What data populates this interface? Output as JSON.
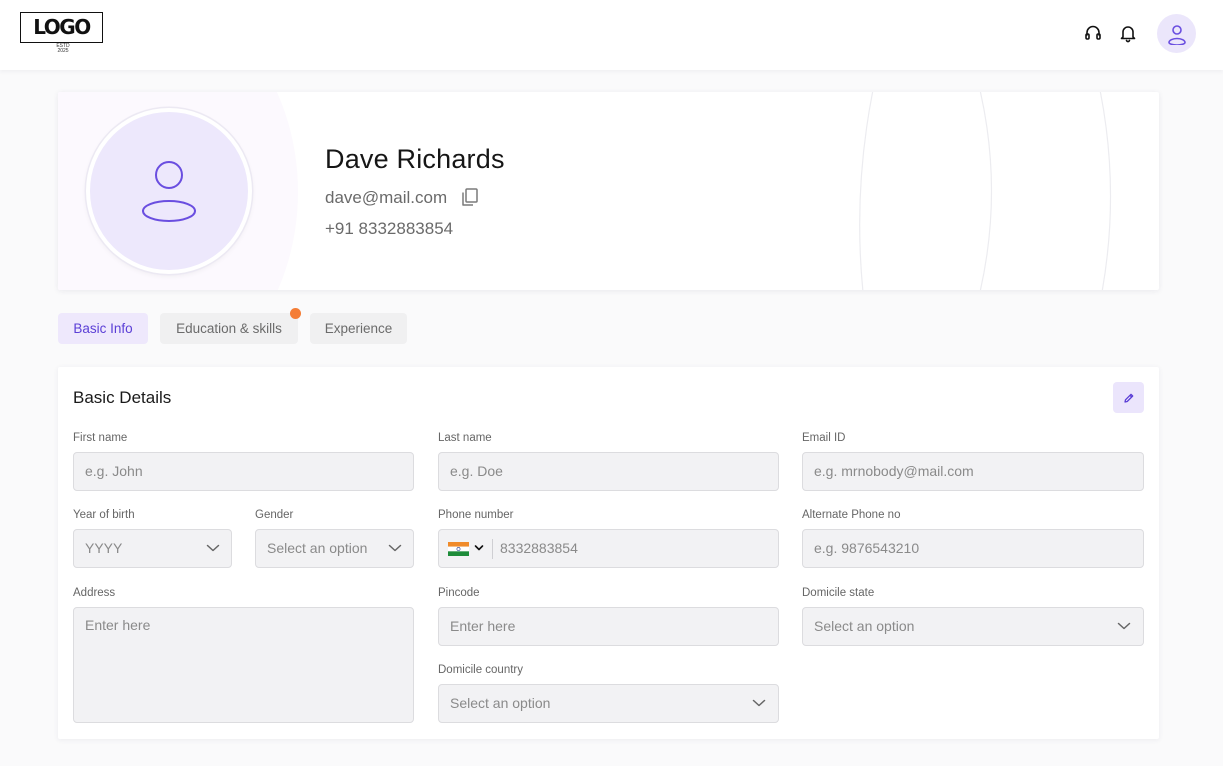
{
  "header": {
    "logo_text": "LOGO",
    "logo_sub": "ESTD\n2025",
    "icons": [
      "headset-icon",
      "bell-icon",
      "user-icon"
    ]
  },
  "profile": {
    "name": "Dave Richards",
    "email": "dave@mail.com",
    "phone": "+91 8332883854"
  },
  "tabs": [
    {
      "label": "Basic Info",
      "active": true
    },
    {
      "label": "Education & skills",
      "active": false,
      "notification": true
    },
    {
      "label": "Experience",
      "active": false
    }
  ],
  "basic_details": {
    "title": "Basic Details",
    "fields": {
      "first_name": {
        "label": "First name",
        "placeholder": "e.g. John"
      },
      "last_name": {
        "label": "Last name",
        "placeholder": "e.g. Doe"
      },
      "email_id": {
        "label": "Email ID",
        "placeholder": "e.g. mrnobody@mail.com"
      },
      "year_of_birth": {
        "label": "Year of birth",
        "placeholder": "YYYY"
      },
      "gender": {
        "label": "Gender",
        "placeholder": "Select an option"
      },
      "phone_number": {
        "label": "Phone number",
        "value": "8332883854",
        "country": "India"
      },
      "alternate_phone": {
        "label": "Alternate Phone no",
        "placeholder": "e.g. 9876543210"
      },
      "address": {
        "label": "Address",
        "placeholder": "Enter here"
      },
      "pincode": {
        "label": "Pincode",
        "placeholder": "Enter here"
      },
      "domicile_state": {
        "label": "Domicile state",
        "placeholder": "Select an option"
      },
      "domicile_country": {
        "label": "Domicile country",
        "placeholder": "Select an option"
      }
    }
  },
  "colors": {
    "accent": "#5b3fd6",
    "accent_light": "#ede8fc",
    "notification": "#f47d36",
    "field_bg": "#f2f2f4"
  }
}
